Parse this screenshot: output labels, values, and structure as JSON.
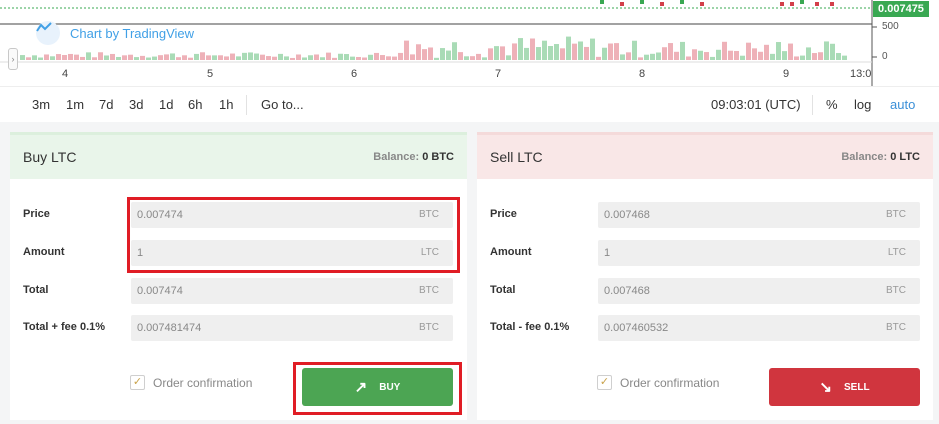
{
  "chart": {
    "attribution": "Chart by TradingView",
    "last_price": "0.007475",
    "y_labels": [
      "500",
      "0"
    ],
    "x_labels": [
      "4",
      "5",
      "6",
      "7",
      "8",
      "9",
      "13:0"
    ],
    "colors": {
      "up": "#39a852",
      "down": "#d33f4a",
      "vol_up": "#a9dbb6",
      "vol_down": "#eeb1b8"
    }
  },
  "toolbar": {
    "ranges": [
      "3m",
      "1m",
      "7d",
      "3d",
      "1d",
      "6h",
      "1h"
    ],
    "goto": "Go to...",
    "time": "09:03:01 (UTC)",
    "percent": "%",
    "log": "log",
    "auto": "auto"
  },
  "buy": {
    "title": "Buy LTC",
    "balance_label": "Balance:",
    "balance_value": "0 BTC",
    "rows": [
      {
        "label": "Price",
        "value": "0.007474",
        "unit": "BTC"
      },
      {
        "label": "Amount",
        "value": "1",
        "unit": "LTC"
      },
      {
        "label": "Total",
        "value": "0.007474",
        "unit": "BTC"
      },
      {
        "label": "Total + fee 0.1%",
        "value": "0.007481474",
        "unit": "BTC"
      }
    ],
    "confirm_label": "Order confirmation",
    "button_label": "BUY"
  },
  "sell": {
    "title": "Sell LTC",
    "balance_label": "Balance:",
    "balance_value": "0 LTC",
    "rows": [
      {
        "label": "Price",
        "value": "0.007468",
        "unit": "BTC"
      },
      {
        "label": "Amount",
        "value": "1",
        "unit": "LTC"
      },
      {
        "label": "Total",
        "value": "0.007468",
        "unit": "BTC"
      },
      {
        "label": "Total - fee 0.1%",
        "value": "0.007460532",
        "unit": "BTC"
      }
    ],
    "confirm_label": "Order confirmation",
    "button_label": "SELL"
  }
}
